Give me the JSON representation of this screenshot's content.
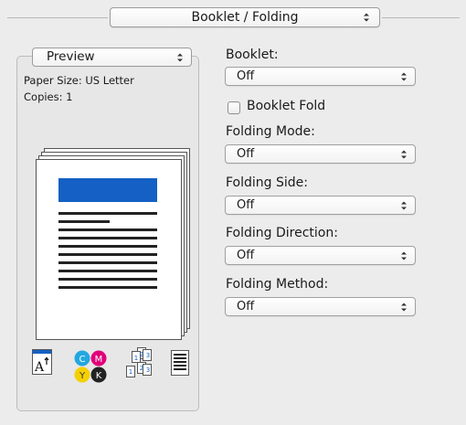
{
  "header": {
    "panel_selector": "Booklet / Folding"
  },
  "preview": {
    "selector": "Preview",
    "paper_size": "Paper Size: US Letter",
    "copies": "Copies: 1",
    "icons": [
      "text-size-icon",
      "cmyk-color-icon",
      "page-order-icon",
      "document-lines-icon"
    ]
  },
  "cmyk": {
    "c": "C",
    "m": "M",
    "y": "Y",
    "k": "K"
  },
  "page_order_digits": {
    "back": [
      "1",
      "2",
      "3"
    ],
    "front": [
      "1",
      "2",
      "3"
    ]
  },
  "settings": {
    "booklet_label": "Booklet:",
    "booklet_value": "Off",
    "booklet_fold_label": "Booklet Fold",
    "booklet_fold_checked": false,
    "folding_mode_label": "Folding Mode:",
    "folding_mode_value": "Off",
    "folding_side_label": "Folding Side:",
    "folding_side_value": "Off",
    "folding_direction_label": "Folding Direction:",
    "folding_direction_value": "Off",
    "folding_method_label": "Folding Method:",
    "folding_method_value": "Off"
  },
  "colors": {
    "accent_blue": "#1460c4",
    "cyan": "#23a7e0",
    "magenta": "#e2007a",
    "yellow": "#f5d000",
    "black": "#222222"
  }
}
